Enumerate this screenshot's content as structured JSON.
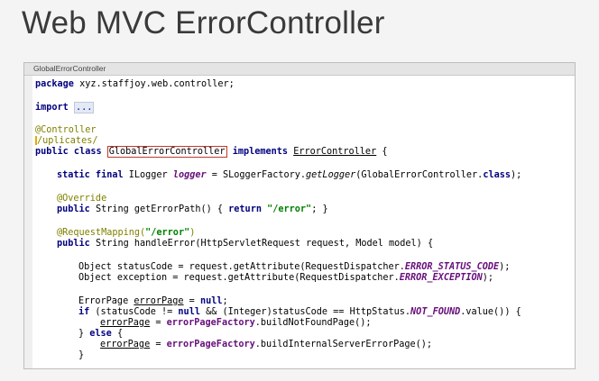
{
  "slide": {
    "title": "Web MVC ErrorController"
  },
  "editor": {
    "tab_label": "GlobalErrorController",
    "lines": {
      "l1": {
        "kw": "package",
        "rest": " xyz.staffjoy.web.controller;"
      },
      "l2": {
        "kw": "import",
        "fold": "..."
      },
      "l3": {
        "ann": "@Controller"
      },
      "l4": {
        "ann": "/uplicates/"
      },
      "l5": {
        "kw1": "public class",
        "cls": "GlobalErrorController",
        "kw2": "implements",
        "iface": "ErrorController",
        "tail": " {"
      },
      "l6": {
        "kw": "static final",
        "a": " ILogger ",
        "field": "logger",
        "b": " = SLoggerFactory.",
        "method": "getLogger",
        "c": "(GlobalErrorController.",
        "kwc": "class",
        "d": ");"
      },
      "l7": {
        "ann": "@Override"
      },
      "l8": {
        "kw": "public",
        "a": " String getErrorPath() { ",
        "kw2": "return",
        "sp": " ",
        "str": "\"/error\"",
        "b": "; }"
      },
      "l9": {
        "ann": "@RequestMapping(",
        "str": "\"/error\"",
        "ann2": ")"
      },
      "l10": {
        "kw": "public",
        "a": " String handleError(HttpServletRequest request, Model model) {"
      },
      "l11": {
        "a": "Object statusCode = request.getAttribute(RequestDispatcher.",
        "const": "ERROR_STATUS_CODE",
        "b": ");"
      },
      "l12": {
        "a": "Object exception = request.getAttribute(RequestDispatcher.",
        "const": "ERROR_EXCEPTION",
        "b": ");"
      },
      "l13": {
        "a": "ErrorPage ",
        "var": "errorPage",
        "b": " = ",
        "kw": "null",
        "c": ";"
      },
      "l14": {
        "kw": "if",
        "a": " (statusCode != ",
        "kw2": "null",
        "b": " && (Integer)statusCode == HttpStatus.",
        "const": "NOT_FOUND",
        "c": ".value()) {"
      },
      "l15": {
        "var": "errorPage",
        "a": " = ",
        "field": "errorPageFactory",
        "b": ".buildNotFoundPage();"
      },
      "l16": {
        "a": "} ",
        "kw": "else",
        "b": " {"
      },
      "l17": {
        "var": "errorPage",
        "a": " = ",
        "field": "errorPageFactory",
        "b": ".buildInternalServerErrorPage();"
      },
      "l18": {
        "a": "}"
      }
    }
  }
}
